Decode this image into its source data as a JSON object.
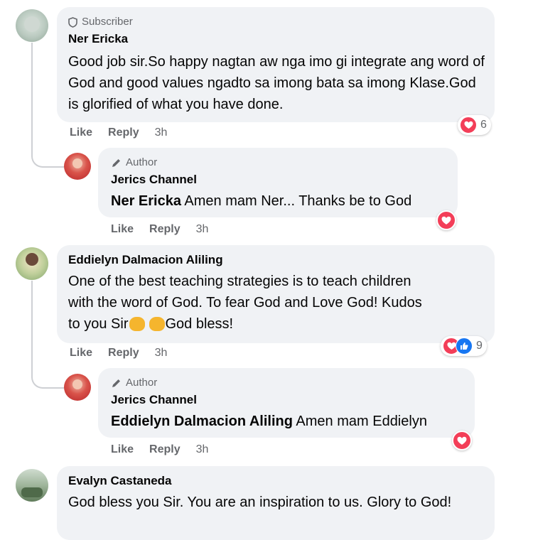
{
  "comments": [
    {
      "badge": "Subscriber",
      "author": "Ner Ericka",
      "text": "Good job sir.So happy nagtan aw nga imo gi integrate ang word of God and good values ngadto sa imong bata sa imong Klase.God is glorified of what you have done.",
      "like": "Like",
      "reply": "Reply",
      "time": "3h",
      "reaction_count": "6",
      "reply_comment": {
        "badge": "Author",
        "author": "Jerics Channel",
        "mention": "Ner Ericka",
        "text": " Amen mam Ner... Thanks be to God",
        "like": "Like",
        "reply": "Reply",
        "time": "3h"
      }
    },
    {
      "author": "Eddielyn Dalmacion Aliling",
      "text_line1": "One of the best teaching strategies is to teach children",
      "text_line2": "with the word of God. To fear God and Love God! Kudos",
      "text_line3_a": "to you Sir",
      "text_line3_b": " God bless!",
      "like": "Like",
      "reply": "Reply",
      "time": "3h",
      "reaction_count": "9",
      "reply_comment": {
        "badge": "Author",
        "author": "Jerics Channel",
        "mention": "Eddielyn Dalmacion Aliling",
        "text": " Amen mam Eddielyn",
        "like": "Like",
        "reply": "Reply",
        "time": "3h"
      }
    },
    {
      "author": "Evalyn Castaneda",
      "text": "God bless you Sir. You are an inspiration to us. Glory to God!"
    }
  ],
  "colors": {
    "bubble": "#f0f2f5",
    "heart": "#f33e58",
    "like": "#1877f2",
    "muted": "#65676b"
  }
}
